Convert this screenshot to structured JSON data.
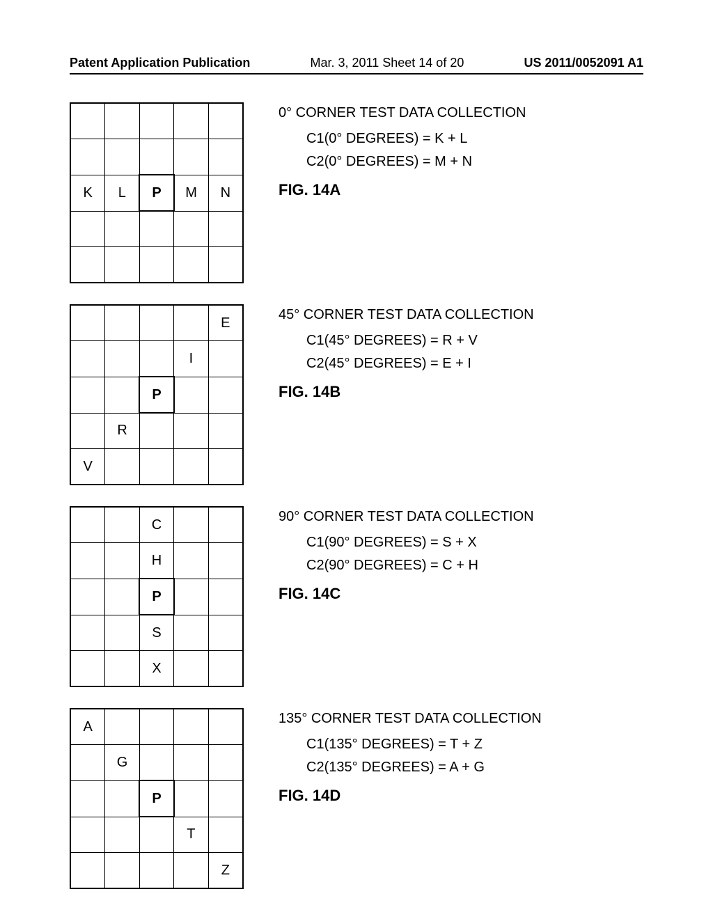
{
  "header": {
    "left": "Patent Application Publication",
    "mid": "Mar. 3, 2011  Sheet 14 of 20",
    "right": "US 2011/0052091 A1"
  },
  "sections": [
    {
      "grid": [
        [
          "",
          "",
          "",
          "",
          ""
        ],
        [
          "",
          "",
          "",
          "",
          ""
        ],
        [
          "K",
          "L",
          "P",
          "M",
          "N"
        ],
        [
          "",
          "",
          "",
          "",
          ""
        ],
        [
          "",
          "",
          "",
          "",
          ""
        ]
      ],
      "title": "0° CORNER TEST DATA COLLECTION",
      "eq1": "C1(0° DEGREES) = K + L",
      "eq2": "C2(0° DEGREES) = M + N",
      "figlabel": "FIG. 14A"
    },
    {
      "grid": [
        [
          "",
          "",
          "",
          "",
          "E"
        ],
        [
          "",
          "",
          "",
          "I",
          ""
        ],
        [
          "",
          "",
          "P",
          "",
          ""
        ],
        [
          "",
          "R",
          "",
          "",
          ""
        ],
        [
          "V",
          "",
          "",
          "",
          ""
        ]
      ],
      "title": "45° CORNER TEST DATA COLLECTION",
      "eq1": "C1(45° DEGREES) = R + V",
      "eq2": "C2(45° DEGREES) = E + I",
      "figlabel": "FIG. 14B"
    },
    {
      "grid": [
        [
          "",
          "",
          "C",
          "",
          ""
        ],
        [
          "",
          "",
          "H",
          "",
          ""
        ],
        [
          "",
          "",
          "P",
          "",
          ""
        ],
        [
          "",
          "",
          "S",
          "",
          ""
        ],
        [
          "",
          "",
          "X",
          "",
          ""
        ]
      ],
      "title": "90° CORNER TEST DATA COLLECTION",
      "eq1": "C1(90° DEGREES) = S + X",
      "eq2": "C2(90° DEGREES) = C + H",
      "figlabel": "FIG. 14C"
    },
    {
      "grid": [
        [
          "A",
          "",
          "",
          "",
          ""
        ],
        [
          "",
          "G",
          "",
          "",
          ""
        ],
        [
          "",
          "",
          "P",
          "",
          ""
        ],
        [
          "",
          "",
          "",
          "T",
          ""
        ],
        [
          "",
          "",
          "",
          "",
          "Z"
        ]
      ],
      "title": "135° CORNER TEST DATA COLLECTION",
      "eq1": "C1(135° DEGREES) = T + Z",
      "eq2": "C2(135° DEGREES) = A + G",
      "figlabel": "FIG. 14D"
    }
  ]
}
